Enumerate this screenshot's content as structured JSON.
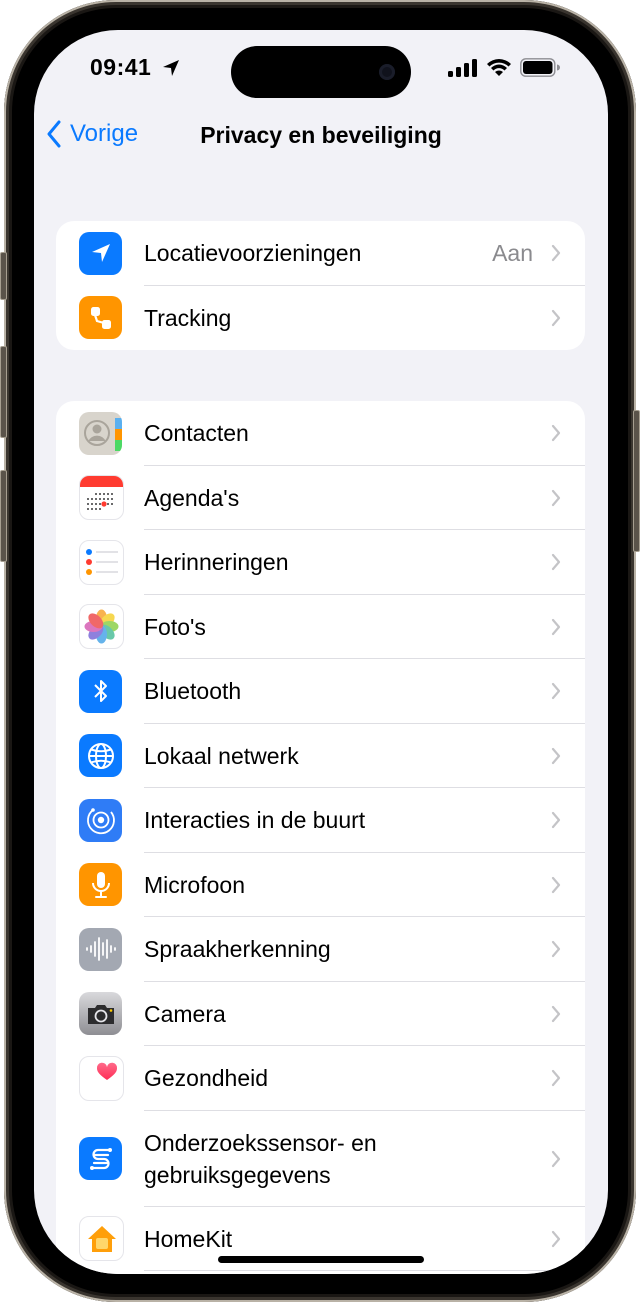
{
  "status_bar": {
    "time": "09:41",
    "location_icon": "location-arrow-icon",
    "signal_icon": "cellular-signal-icon",
    "wifi_icon": "wifi-icon",
    "battery_icon": "battery-icon"
  },
  "nav": {
    "back_label": "Vorige",
    "title": "Privacy en beveiliging"
  },
  "groups": [
    {
      "items": [
        {
          "label": "Locatievoorzieningen",
          "value": "Aan",
          "icon": "location-icon",
          "color": "#0a7aff"
        },
        {
          "label": "Tracking",
          "value": "",
          "icon": "tracking-icon",
          "color": "#ff9500"
        }
      ]
    },
    {
      "items": [
        {
          "label": "Contacten",
          "icon": "contacts-icon",
          "color": "#d8d4cc"
        },
        {
          "label": "Agenda's",
          "icon": "calendar-icon",
          "color": "#ffffff"
        },
        {
          "label": "Herinneringen",
          "icon": "reminders-icon",
          "color": "#ffffff"
        },
        {
          "label": "Foto's",
          "icon": "photos-icon",
          "color": "#ffffff"
        },
        {
          "label": "Bluetooth",
          "icon": "bluetooth-icon",
          "color": "#0a7aff"
        },
        {
          "label": "Lokaal netwerk",
          "icon": "globe-icon",
          "color": "#0a7aff"
        },
        {
          "label": "Interacties in de buurt",
          "icon": "nearby-interactions-icon",
          "color": "#2f7cf6"
        },
        {
          "label": "Microfoon",
          "icon": "microphone-icon",
          "color": "#ff9500"
        },
        {
          "label": "Spraakherkenning",
          "icon": "waveform-icon",
          "color": "#a3a8b2"
        },
        {
          "label": "Camera",
          "icon": "camera-icon",
          "color": "#9a9a9e"
        },
        {
          "label": "Gezondheid",
          "icon": "health-heart-icon",
          "color": "#ffffff"
        },
        {
          "label": "Onderzoekssensor- en gebruiksgegevens",
          "label_line1": "Onderzoekssensor- en",
          "label_line2": "gebruiksgegevens",
          "icon": "research-sensor-icon",
          "color": "#0a7aff"
        },
        {
          "label": "HomeKit",
          "icon": "homekit-icon",
          "color": "#ffffff"
        }
      ]
    }
  ]
}
